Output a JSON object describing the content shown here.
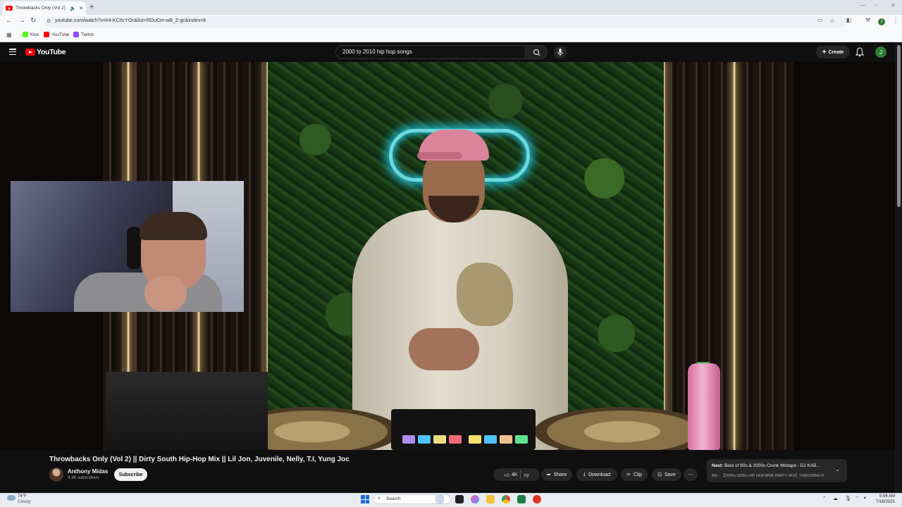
{
  "browser": {
    "tab_title": "Throwbacks Only (Vol 2) ||",
    "url": "youtube.com/watch?v=lr4-KC0cYOc&list=RDuCm-wB_Z-gc&index=6",
    "bookmarks": [
      {
        "label": "Kick",
        "color": "#53fc18"
      },
      {
        "label": "YouTube",
        "color": "#ff0000"
      },
      {
        "label": "Twitch",
        "color": "#9146ff"
      }
    ],
    "profile_initial": "J"
  },
  "youtube": {
    "logo_text": "YouTube",
    "search_query": "2000 to 2010 hip hop songs",
    "create_label": "Create",
    "avatar_initial": "J"
  },
  "video": {
    "title": "Throwbacks Only (Vol 2) || Dirty South Hip-Hop Mix || Lil Jon, Juvenile, Nelly, T.I, Yung Joc",
    "channel": "Anthony Midas",
    "subscribers": "4.3K subscribers",
    "subscribe_label": "Subscribe",
    "likes": "4K",
    "share_label": "Share",
    "download_label": "Download",
    "clip_label": "Clip",
    "save_label": "Save"
  },
  "next_up": {
    "prefix": "Next:",
    "title": "Best of 90s & 2000s Crunk Mixtape - DJ KAB...",
    "subtitle": "Mix · 【2000s-2005s HIP HOP/RNB PARTY MIX】THROWBACK"
  },
  "taskbar": {
    "temperature": "74°F",
    "weather": "Cloudy",
    "search_label": "Search",
    "time": "5:06 AM",
    "date": "7/16/2025"
  },
  "colors": {
    "youtube_red": "#ff0000",
    "yt_dark": "#0f0f0f",
    "accent_blue": "#1d6fd6"
  }
}
